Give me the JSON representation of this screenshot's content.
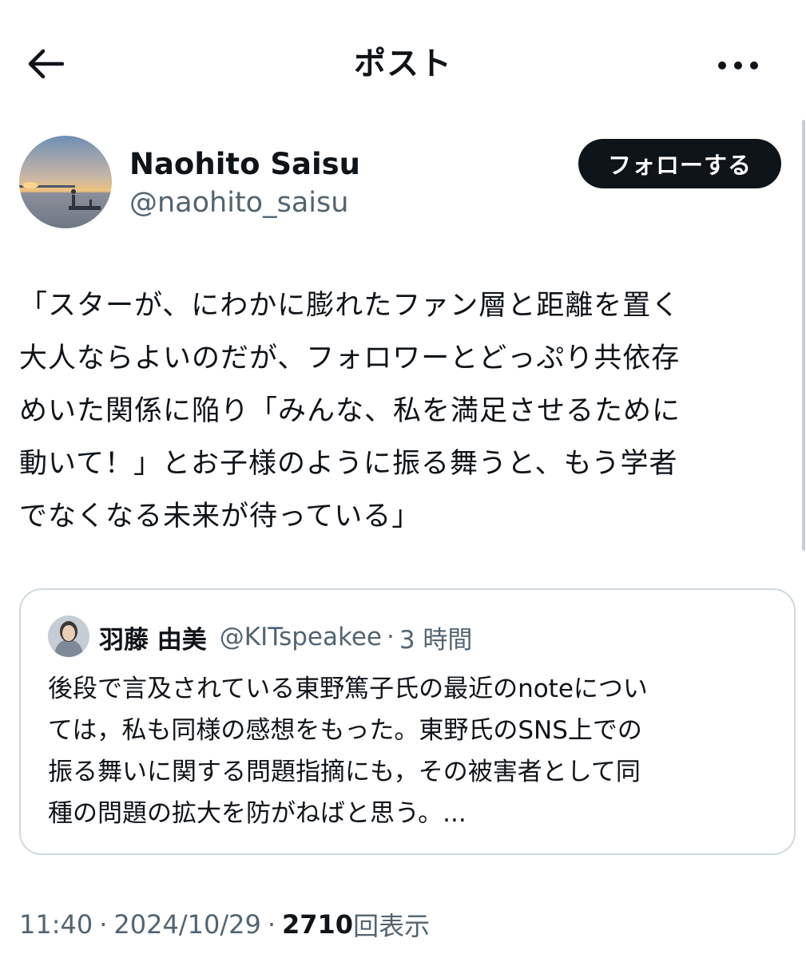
{
  "header": {
    "title": "ポスト"
  },
  "author": {
    "display_name": "Naohito Saisu",
    "handle": "@naohito_saisu"
  },
  "follow_button": {
    "label": "フォローする"
  },
  "post": {
    "text": "「スターが、にわかに膨れたファン層と距離を置く\n大人ならよいのだが、フォロワーとどっぷり共依存\nめいた関係に陥り「みんな、私を満足させるために\n動いて！」とお子様のように振る舞うと、もう学者\nでなくなる未来が待っている」"
  },
  "quoted_post": {
    "author_name": "羽藤 由美",
    "handle": "@KITspeakee",
    "separator": "·",
    "time": "3 時間",
    "text": "後段で言及されている東野篤子氏の最近のnoteについ\nては，私も同様の感想をもった。東野氏のSNS上での\n振る舞いに関する問題指摘にも，その被害者として同\n種の問題の拡大を防がねばと思う。..."
  },
  "meta": {
    "time": "11:40",
    "separator": "·",
    "date": "2024/10/29",
    "views_count": "2710",
    "views_label": "回表示"
  },
  "icons": {
    "back": "back-arrow-icon",
    "more": "more-horizontal-icon"
  },
  "colors": {
    "text_primary": "#0f1419",
    "text_secondary": "#536471",
    "follow_button_bg": "#0f1419",
    "border": "#cfd9de"
  }
}
